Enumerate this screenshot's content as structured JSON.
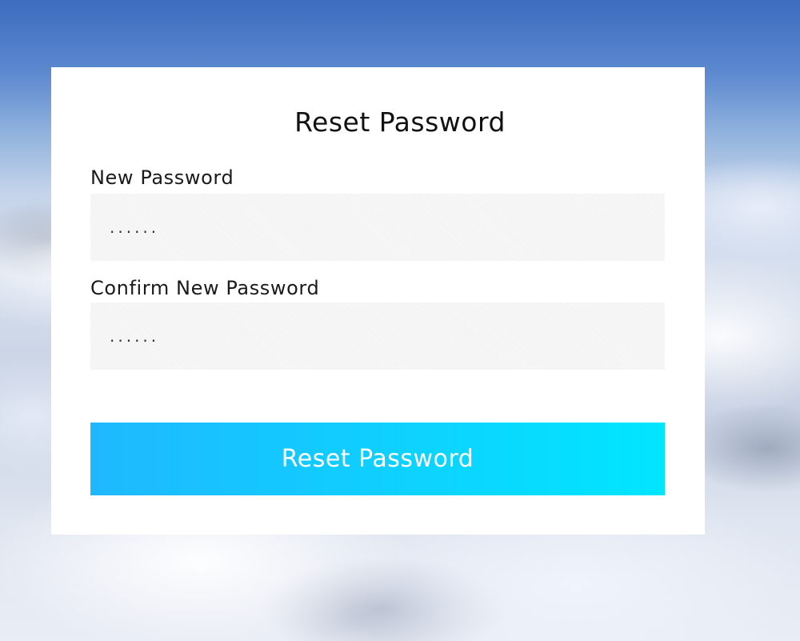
{
  "form": {
    "title": "Reset Password",
    "new_password": {
      "label": "New Password",
      "value": "......"
    },
    "confirm_password": {
      "label": "Confirm New Password",
      "value": "......"
    },
    "submit_label": "Reset Password"
  },
  "colors": {
    "button_gradient_start": "#1fb8ff",
    "button_gradient_end": "#00e6ff",
    "card_background": "#ffffff",
    "input_background": "#f7f7f7"
  }
}
